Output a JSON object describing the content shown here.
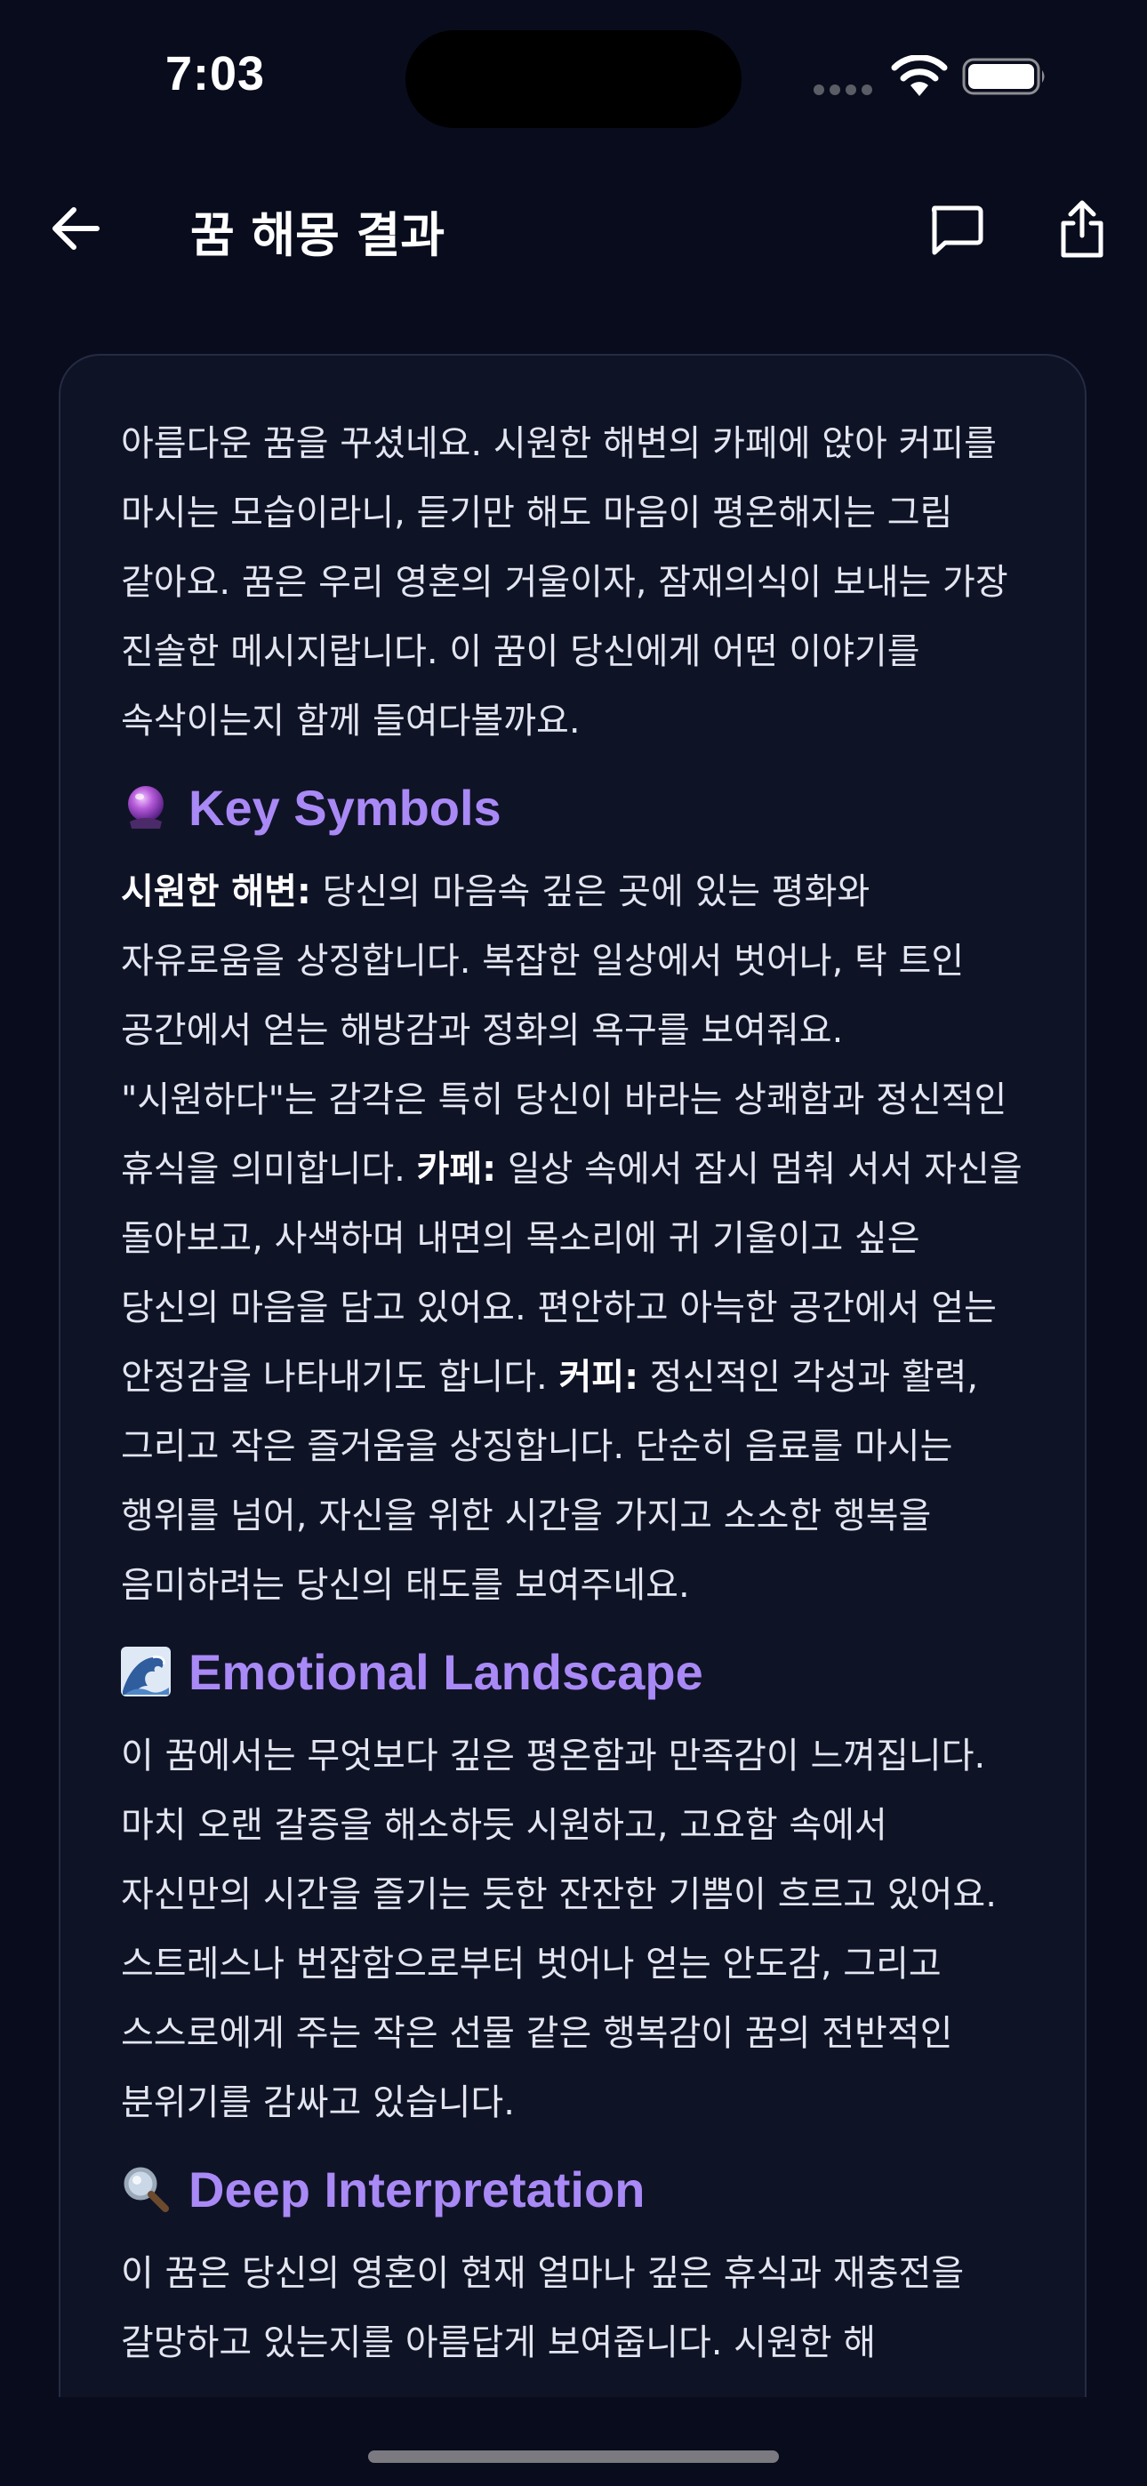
{
  "status_bar": {
    "time": "7:03"
  },
  "header": {
    "title": "꿈 해몽 결과",
    "back_icon": "arrow-left-icon",
    "chat_icon": "chat-bubble-icon",
    "share_icon": "share-icon"
  },
  "content": {
    "intro": "아름다운 꿈을 꾸셨네요. 시원한 해변의 카페에 앉아 커피를 마시는 모습이라니, 듣기만 해도 마음이 평온해지는 그림 같아요. 꿈은 우리 영혼의 거울이자, 잠재의식이 보내는 가장 진솔한 메시지랍니다. 이 꿈이 당신에게 어떤 이야기를 속삭이는지 함께 들여다볼까요.",
    "sections": [
      {
        "icon": "crystal-ball-icon",
        "title": "Key Symbols",
        "parts": [
          {
            "term": "시원한 해변:",
            "text": " 당신의 마음속 깊은 곳에 있는 평화와 자유로움을 상징합니다. 복잡한 일상에서 벗어나, 탁 트인 공간에서 얻는 해방감과 정화의 욕구를 보여줘요. \"시원하다\"는 감각은 특히 당신이 바라는 상쾌함과 정신적인 휴식을 의미합니다. "
          },
          {
            "term": "카페:",
            "text": " 일상 속에서 잠시 멈춰 서서 자신을 돌아보고, 사색하며 내면의 목소리에 귀 기울이고 싶은 당신의 마음을 담고 있어요. 편안하고 아늑한 공간에서 얻는 안정감을 나타내기도 합니다. "
          },
          {
            "term": "커피:",
            "text": " 정신적인 각성과 활력, 그리고 작은 즐거움을 상징합니다. 단순히 음료를 마시는 행위를 넘어, 자신을 위한 시간을 가지고 소소한 행복을 음미하려는 당신의 태도를 보여주네요."
          }
        ]
      },
      {
        "icon": "wave-icon",
        "title": "Emotional Landscape",
        "text": "이 꿈에서는 무엇보다 깊은 평온함과 만족감이 느껴집니다. 마치 오랜 갈증을 해소하듯 시원하고, 고요함 속에서 자신만의 시간을 즐기는 듯한 잔잔한 기쁨이 흐르고 있어요. 스트레스나 번잡함으로부터 벗어나 얻는 안도감, 그리고 스스로에게 주는 작은 선물 같은 행복감이 꿈의 전반적인 분위기를 감싸고 있습니다."
      },
      {
        "icon": "magnifier-icon",
        "title": "Deep Interpretation",
        "text": "이 꿈은 당신의 영혼이 현재 얼마나 깊은 휴식과 재충전을 갈망하고 있는지를 아름답게 보여줍니다. 시원한 해"
      }
    ]
  },
  "colors": {
    "background": "#090c1c",
    "card": "#0f1326",
    "accent": "#a989f5",
    "text": "#e3e6f0"
  }
}
